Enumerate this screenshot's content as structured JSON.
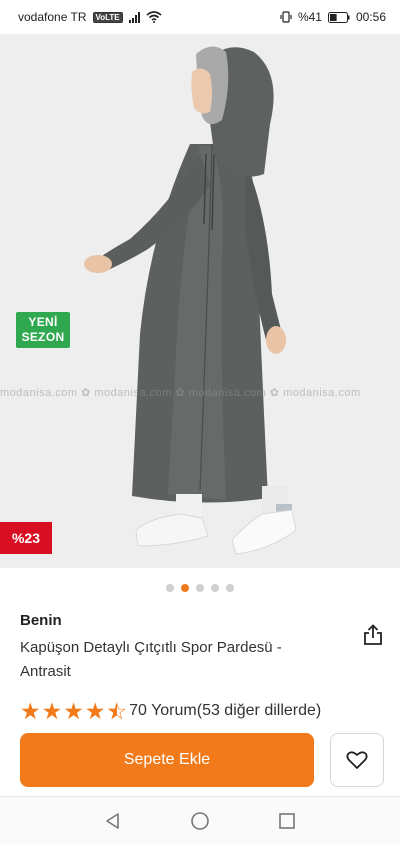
{
  "status_bar": {
    "carrier": "vodafone TR",
    "volte": "VoLTE",
    "battery_level": "41",
    "battery_percent": "%41",
    "time": "00:56"
  },
  "product_image": {
    "badge_new_season_line1": "YENİ",
    "badge_new_season_line2": "SEZON",
    "watermark": "modanisa.com ✿ modanisa.com ✿ modanisa.com ✿ modanisa.com",
    "discount": "%23",
    "pager_total": 5,
    "pager_active_index": 1
  },
  "product": {
    "brand": "Benin",
    "title": "Kapüşon Detaylı Çıtçıtlı Spor Pardesü - Antrasit",
    "rating": 4.5,
    "reviews": "70 Yorum",
    "other_languages": "(53 diğer dillerde)"
  },
  "actions": {
    "add_to_cart": "Sepete Ekle"
  },
  "colors": {
    "accent": "#f27a1a",
    "discount_red": "#d80f23",
    "new_season_green": "#2fa84f"
  },
  "icons": [
    "share-icon",
    "heart-icon",
    "back-icon",
    "home-icon",
    "recents-icon"
  ]
}
